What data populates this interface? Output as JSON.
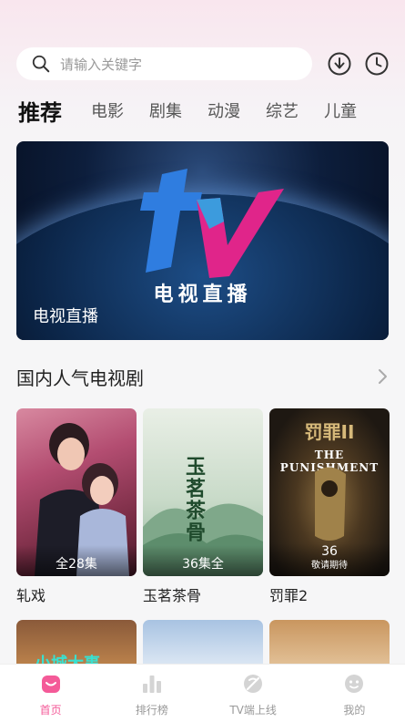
{
  "search": {
    "placeholder": "请输入关键字"
  },
  "header_icons": [
    "download-icon",
    "history-icon"
  ],
  "tabs": [
    "推荐",
    "电影",
    "剧集",
    "动漫",
    "综艺",
    "儿童"
  ],
  "banner": {
    "logo_text": "电视直播",
    "caption": "电视直播"
  },
  "section": {
    "title": "国内人气电视剧"
  },
  "cards": [
    {
      "title": "轧戏",
      "episodes": "全28集"
    },
    {
      "title": "玉茗茶骨",
      "episodes": "36集全"
    },
    {
      "title": "罚罪2",
      "episodes": "36",
      "note": "敬请期待"
    }
  ],
  "poster_text": {
    "p2_title": "玉茗茶骨",
    "p3_title_cn": "罚罪II",
    "p3_title_en": "THE PUNISHMENT",
    "p4_title": "小城大事"
  },
  "colors": {
    "accent": "#f45a98"
  },
  "tabbar": [
    {
      "label": "首页",
      "icon": "home-icon",
      "active": true
    },
    {
      "label": "排行榜",
      "icon": "ranking-icon",
      "active": false
    },
    {
      "label": "TV端上线",
      "icon": "tv-icon",
      "active": false
    },
    {
      "label": "我的",
      "icon": "profile-icon",
      "active": false
    }
  ]
}
